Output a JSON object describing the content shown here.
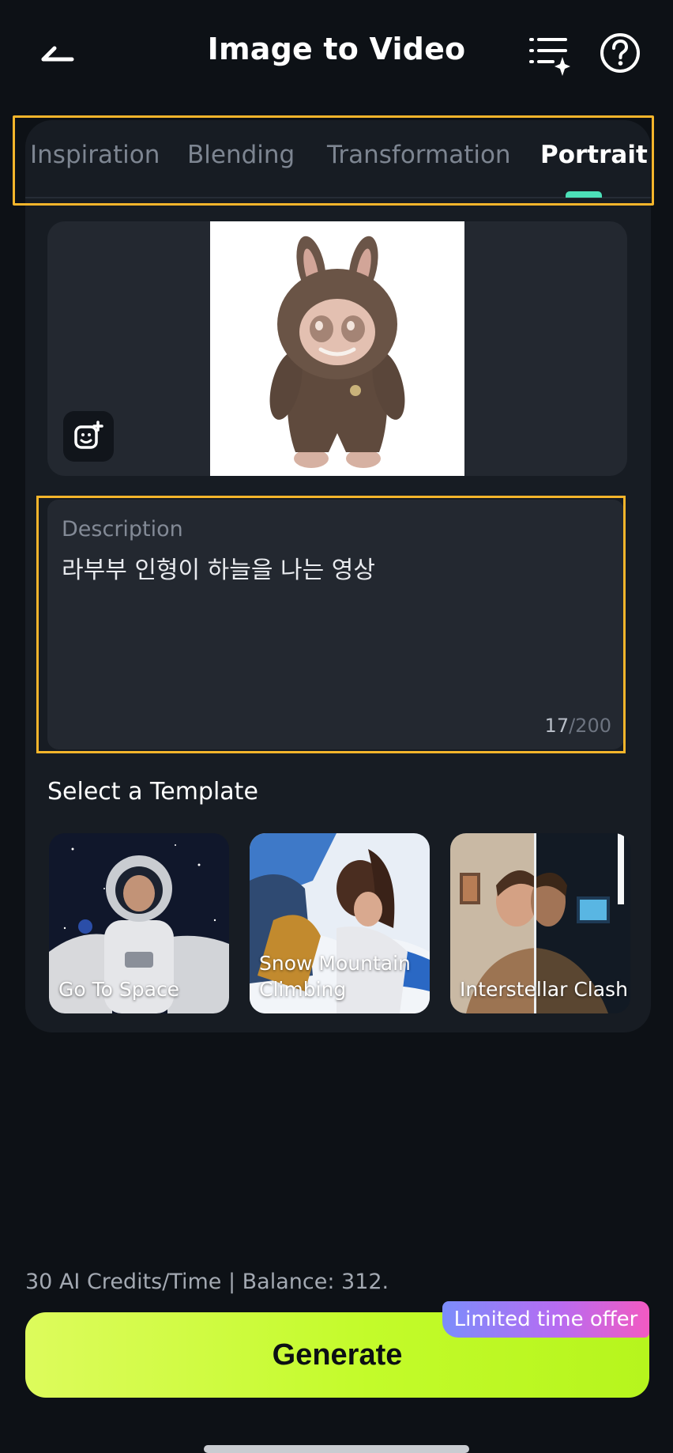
{
  "header": {
    "title": "Image to Video"
  },
  "tabs": [
    {
      "label": "Inspiration"
    },
    {
      "label": "Blending"
    },
    {
      "label": "Transformation"
    },
    {
      "label": "Portrait"
    }
  ],
  "active_tab": "Portrait",
  "description": {
    "label": "Description",
    "value": "라부부 인형이 하늘을 나는 영상",
    "count": "17",
    "max": "/200"
  },
  "templates": {
    "title": "Select a Template",
    "items": [
      {
        "label": "Go To Space"
      },
      {
        "label": "Snow Mountain Climbing"
      },
      {
        "label": "Interstellar Clash"
      }
    ]
  },
  "footer": {
    "credits": "30 AI Credits/Time | Balance: 312.",
    "generate_label": "Generate",
    "offer_badge": "Limited time offer"
  },
  "colors": {
    "accent_generate": "#c3fb2a",
    "tab_indicator": "#4ce0b8",
    "highlight_box": "#f5b52b"
  }
}
